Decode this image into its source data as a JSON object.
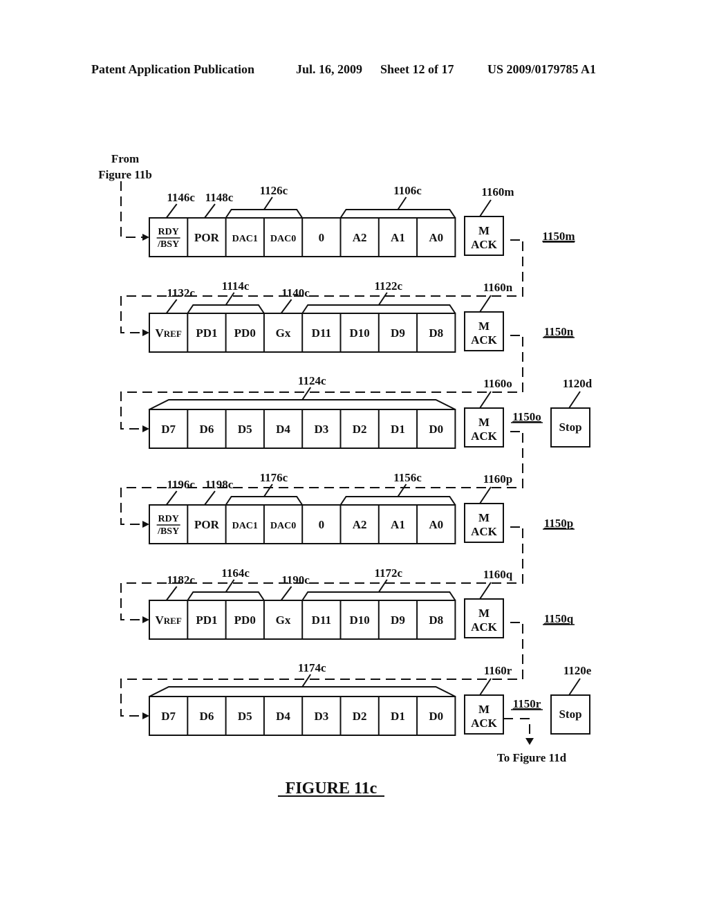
{
  "header": {
    "publication": "Patent Application Publication",
    "date": "Jul. 16, 2009",
    "sheet": "Sheet 12 of 17",
    "number": "US 2009/0179785 A1"
  },
  "from_label": [
    "From",
    "Figure 11b"
  ],
  "to_label": "To Figure 11d",
  "figure_title": "FIGURE 11c",
  "rows": [
    {
      "id": "1150m",
      "ack_label": "1160m",
      "cells": [
        "RDY/BSY",
        "POR",
        "DAC1",
        "DAC0",
        "0",
        "A2",
        "A1",
        "A0"
      ],
      "callouts": [
        {
          "label": "1146c",
          "cell": 0,
          "type": "single"
        },
        {
          "label": "1148c",
          "cell": 1,
          "type": "single"
        },
        {
          "label": "1126c",
          "cells": [
            2,
            3
          ],
          "type": "brace"
        },
        {
          "label": "1106c",
          "cells": [
            5,
            7
          ],
          "type": "brace"
        }
      ],
      "stop": null
    },
    {
      "id": "1150n",
      "ack_label": "1160n",
      "cells": [
        "VREF",
        "PD1",
        "PD0",
        "Gx",
        "D11",
        "D10",
        "D9",
        "D8"
      ],
      "callouts": [
        {
          "label": "1132c",
          "cell": 0,
          "type": "single"
        },
        {
          "label": "1114c",
          "cells": [
            1,
            2
          ],
          "type": "brace"
        },
        {
          "label": "1140c",
          "cell": 3,
          "type": "single"
        },
        {
          "label": "1122c",
          "cells": [
            4,
            7
          ],
          "type": "brace"
        }
      ],
      "stop": null
    },
    {
      "id": "1150o",
      "ack_label": "1160o",
      "cells": [
        "D7",
        "D6",
        "D5",
        "D4",
        "D3",
        "D2",
        "D1",
        "D0"
      ],
      "callouts": [
        {
          "label": "1124c",
          "cells": [
            0,
            7
          ],
          "type": "brace"
        }
      ],
      "stop": {
        "label": "Stop",
        "ref": "1120d"
      }
    },
    {
      "id": "1150p",
      "ack_label": "1160p",
      "cells": [
        "RDY/BSY",
        "POR",
        "DAC1",
        "DAC0",
        "0",
        "A2",
        "A1",
        "A0"
      ],
      "callouts": [
        {
          "label": "1196c",
          "cell": 0,
          "type": "single"
        },
        {
          "label": "1198c",
          "cell": 1,
          "type": "single"
        },
        {
          "label": "1176c",
          "cells": [
            2,
            3
          ],
          "type": "brace"
        },
        {
          "label": "1156c",
          "cells": [
            5,
            7
          ],
          "type": "brace"
        }
      ],
      "stop": null
    },
    {
      "id": "1150q",
      "ack_label": "1160q",
      "cells": [
        "VREF",
        "PD1",
        "PD0",
        "Gx",
        "D11",
        "D10",
        "D9",
        "D8"
      ],
      "callouts": [
        {
          "label": "1182c",
          "cell": 0,
          "type": "single"
        },
        {
          "label": "1164c",
          "cells": [
            1,
            2
          ],
          "type": "brace"
        },
        {
          "label": "1190c",
          "cell": 3,
          "type": "single"
        },
        {
          "label": "1172c",
          "cells": [
            4,
            7
          ],
          "type": "brace"
        }
      ],
      "stop": null
    },
    {
      "id": "1150r",
      "ack_label": "1160r",
      "cells": [
        "D7",
        "D6",
        "D5",
        "D4",
        "D3",
        "D2",
        "D1",
        "D0"
      ],
      "callouts": [
        {
          "label": "1174c",
          "cells": [
            0,
            7
          ],
          "type": "brace"
        }
      ],
      "stop": {
        "label": "Stop",
        "ref": "1120e"
      }
    }
  ],
  "ack_text": [
    "M",
    "ACK"
  ]
}
